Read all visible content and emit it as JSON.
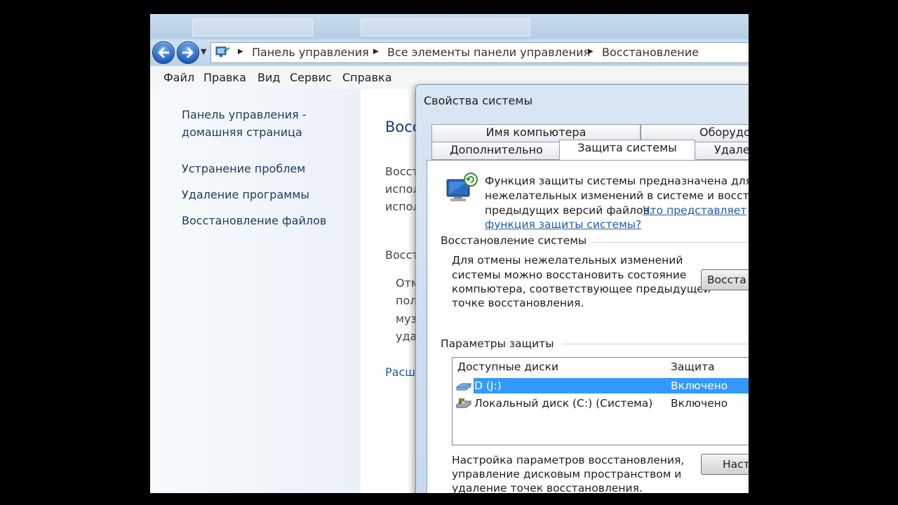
{
  "address_bar": {
    "crumbs": [
      "Панель управления",
      "Все элементы панели управления",
      "Восстановление"
    ]
  },
  "menu": [
    "Файл",
    "Правка",
    "Вид",
    "Сервис",
    "Справка"
  ],
  "left_pane": {
    "home_line1": "Панель управления -",
    "home_line2": "домашняя страница",
    "links": [
      "Устранение проблем",
      "Удаление программы",
      "Восстановление файлов"
    ]
  },
  "main_partial": {
    "title": "Восс",
    "lines1": [
      "Восст",
      "испол",
      "испол"
    ],
    "section": "Восст",
    "lines2": [
      "Отм",
      "пол",
      "муз",
      "уда"
    ],
    "link": "Расш"
  },
  "dialog": {
    "title": "Свойства системы",
    "tabs_back": [
      "Имя компьютера",
      "Оборудо"
    ],
    "tabs_front": [
      "Дополнительно",
      "Защита системы",
      "Удале"
    ],
    "intro_lines": [
      "Функция защиты системы предназначена для от",
      "нежелательных изменений в системе и восстано",
      "предыдущих версий файлов."
    ],
    "intro_link_part1": "Что представляет",
    "intro_link_part2": "функция защиты системы?",
    "restore_group_label": "Восстановление системы",
    "restore_lines": [
      "Для отмены нежелательных изменений",
      "системы можно восстановить состояние",
      "компьютера, соответствующее предыдущей",
      "точке восстановления."
    ],
    "restore_button": "Восста",
    "protection_group_label": "Параметры защиты",
    "list_headers": [
      "Доступные диски",
      "Защита"
    ],
    "drives": [
      {
        "name": "D (J:)",
        "status": "Включено",
        "icon": "removable-drive-icon"
      },
      {
        "name": "Локальный диск (C:) (Система)",
        "status": "Включено",
        "icon": "system-drive-icon"
      }
    ],
    "config_lines": [
      "Настройка параметров восстановления,",
      "управление дисковым пространством и",
      "удаление точек восстановления."
    ],
    "config_button": "Наст"
  },
  "colors": {
    "selection": "#3399ff",
    "link": "#1f5ba8",
    "title_blue": "#1e3287"
  }
}
